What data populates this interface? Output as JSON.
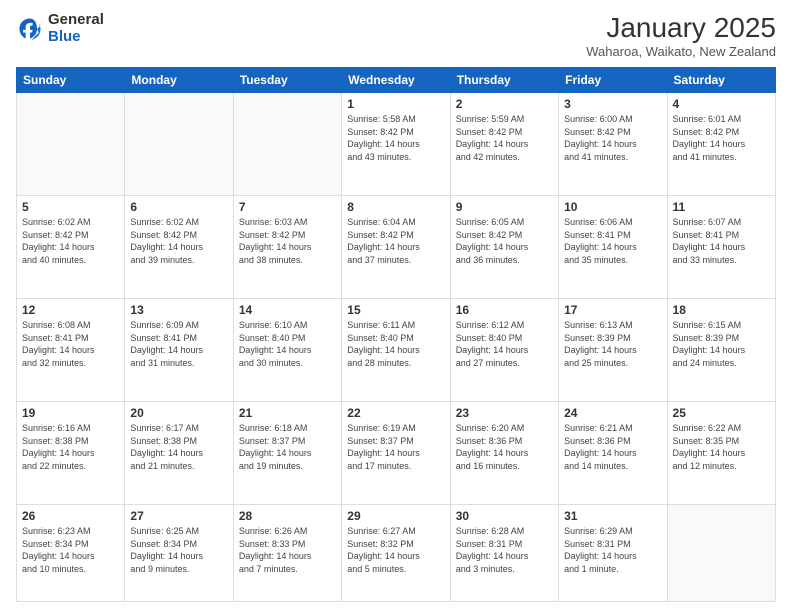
{
  "header": {
    "logo_general": "General",
    "logo_blue": "Blue",
    "month_year": "January 2025",
    "location": "Waharoa, Waikato, New Zealand"
  },
  "days_of_week": [
    "Sunday",
    "Monday",
    "Tuesday",
    "Wednesday",
    "Thursday",
    "Friday",
    "Saturday"
  ],
  "weeks": [
    [
      {
        "day": "",
        "info": ""
      },
      {
        "day": "",
        "info": ""
      },
      {
        "day": "",
        "info": ""
      },
      {
        "day": "1",
        "info": "Sunrise: 5:58 AM\nSunset: 8:42 PM\nDaylight: 14 hours\nand 43 minutes."
      },
      {
        "day": "2",
        "info": "Sunrise: 5:59 AM\nSunset: 8:42 PM\nDaylight: 14 hours\nand 42 minutes."
      },
      {
        "day": "3",
        "info": "Sunrise: 6:00 AM\nSunset: 8:42 PM\nDaylight: 14 hours\nand 41 minutes."
      },
      {
        "day": "4",
        "info": "Sunrise: 6:01 AM\nSunset: 8:42 PM\nDaylight: 14 hours\nand 41 minutes."
      }
    ],
    [
      {
        "day": "5",
        "info": "Sunrise: 6:02 AM\nSunset: 8:42 PM\nDaylight: 14 hours\nand 40 minutes."
      },
      {
        "day": "6",
        "info": "Sunrise: 6:02 AM\nSunset: 8:42 PM\nDaylight: 14 hours\nand 39 minutes."
      },
      {
        "day": "7",
        "info": "Sunrise: 6:03 AM\nSunset: 8:42 PM\nDaylight: 14 hours\nand 38 minutes."
      },
      {
        "day": "8",
        "info": "Sunrise: 6:04 AM\nSunset: 8:42 PM\nDaylight: 14 hours\nand 37 minutes."
      },
      {
        "day": "9",
        "info": "Sunrise: 6:05 AM\nSunset: 8:42 PM\nDaylight: 14 hours\nand 36 minutes."
      },
      {
        "day": "10",
        "info": "Sunrise: 6:06 AM\nSunset: 8:41 PM\nDaylight: 14 hours\nand 35 minutes."
      },
      {
        "day": "11",
        "info": "Sunrise: 6:07 AM\nSunset: 8:41 PM\nDaylight: 14 hours\nand 33 minutes."
      }
    ],
    [
      {
        "day": "12",
        "info": "Sunrise: 6:08 AM\nSunset: 8:41 PM\nDaylight: 14 hours\nand 32 minutes."
      },
      {
        "day": "13",
        "info": "Sunrise: 6:09 AM\nSunset: 8:41 PM\nDaylight: 14 hours\nand 31 minutes."
      },
      {
        "day": "14",
        "info": "Sunrise: 6:10 AM\nSunset: 8:40 PM\nDaylight: 14 hours\nand 30 minutes."
      },
      {
        "day": "15",
        "info": "Sunrise: 6:11 AM\nSunset: 8:40 PM\nDaylight: 14 hours\nand 28 minutes."
      },
      {
        "day": "16",
        "info": "Sunrise: 6:12 AM\nSunset: 8:40 PM\nDaylight: 14 hours\nand 27 minutes."
      },
      {
        "day": "17",
        "info": "Sunrise: 6:13 AM\nSunset: 8:39 PM\nDaylight: 14 hours\nand 25 minutes."
      },
      {
        "day": "18",
        "info": "Sunrise: 6:15 AM\nSunset: 8:39 PM\nDaylight: 14 hours\nand 24 minutes."
      }
    ],
    [
      {
        "day": "19",
        "info": "Sunrise: 6:16 AM\nSunset: 8:38 PM\nDaylight: 14 hours\nand 22 minutes."
      },
      {
        "day": "20",
        "info": "Sunrise: 6:17 AM\nSunset: 8:38 PM\nDaylight: 14 hours\nand 21 minutes."
      },
      {
        "day": "21",
        "info": "Sunrise: 6:18 AM\nSunset: 8:37 PM\nDaylight: 14 hours\nand 19 minutes."
      },
      {
        "day": "22",
        "info": "Sunrise: 6:19 AM\nSunset: 8:37 PM\nDaylight: 14 hours\nand 17 minutes."
      },
      {
        "day": "23",
        "info": "Sunrise: 6:20 AM\nSunset: 8:36 PM\nDaylight: 14 hours\nand 16 minutes."
      },
      {
        "day": "24",
        "info": "Sunrise: 6:21 AM\nSunset: 8:36 PM\nDaylight: 14 hours\nand 14 minutes."
      },
      {
        "day": "25",
        "info": "Sunrise: 6:22 AM\nSunset: 8:35 PM\nDaylight: 14 hours\nand 12 minutes."
      }
    ],
    [
      {
        "day": "26",
        "info": "Sunrise: 6:23 AM\nSunset: 8:34 PM\nDaylight: 14 hours\nand 10 minutes."
      },
      {
        "day": "27",
        "info": "Sunrise: 6:25 AM\nSunset: 8:34 PM\nDaylight: 14 hours\nand 9 minutes."
      },
      {
        "day": "28",
        "info": "Sunrise: 6:26 AM\nSunset: 8:33 PM\nDaylight: 14 hours\nand 7 minutes."
      },
      {
        "day": "29",
        "info": "Sunrise: 6:27 AM\nSunset: 8:32 PM\nDaylight: 14 hours\nand 5 minutes."
      },
      {
        "day": "30",
        "info": "Sunrise: 6:28 AM\nSunset: 8:31 PM\nDaylight: 14 hours\nand 3 minutes."
      },
      {
        "day": "31",
        "info": "Sunrise: 6:29 AM\nSunset: 8:31 PM\nDaylight: 14 hours\nand 1 minute."
      },
      {
        "day": "",
        "info": ""
      }
    ]
  ]
}
